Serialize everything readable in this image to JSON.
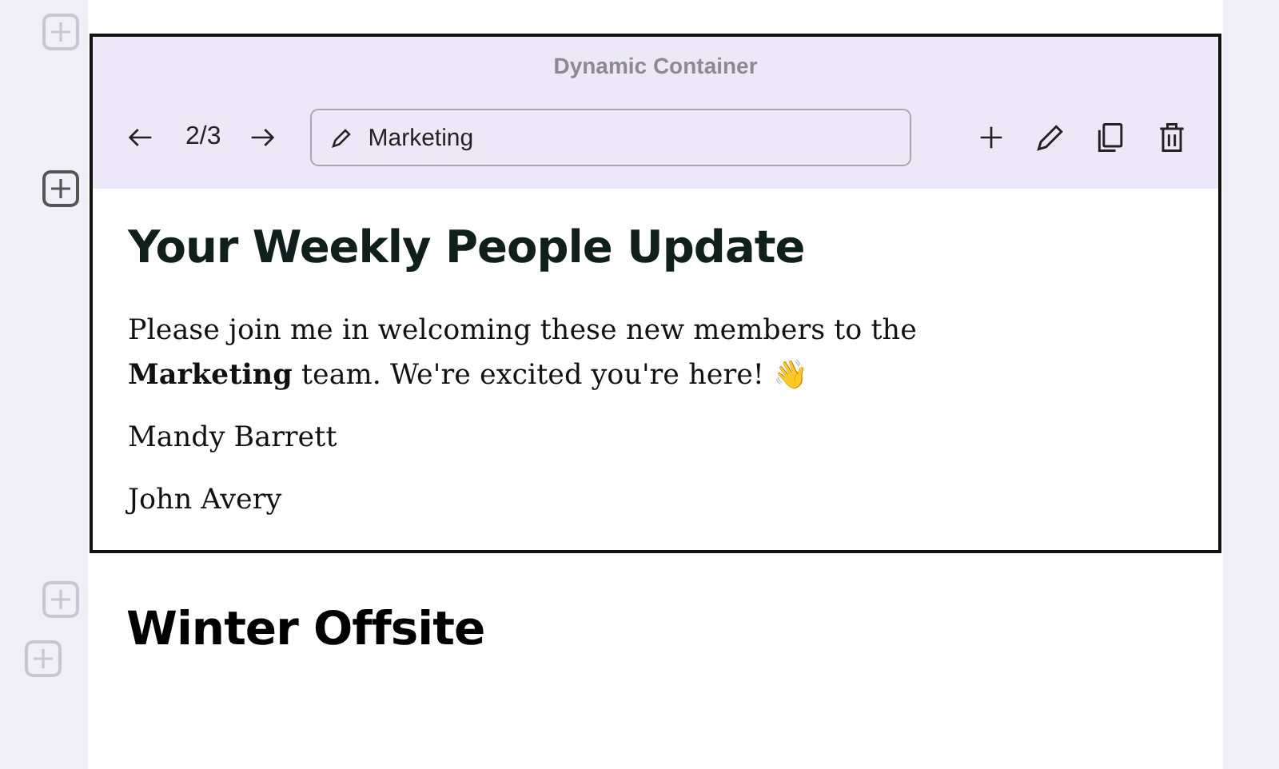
{
  "gutter_buttons": [
    {
      "highlighted": false
    },
    {
      "highlighted": true
    },
    {
      "highlighted": false
    },
    {
      "highlighted": false
    }
  ],
  "container": {
    "title": "Dynamic Container",
    "pager": {
      "current": "2/3"
    },
    "name_field": {
      "value": "Marketing"
    }
  },
  "content": {
    "heading": "Your Weekly People Update",
    "paragraphs": [
      "Please join me in welcoming these new members to the **Marketing** team. We're excited you're here! 👋",
      "Mandy Barrett",
      "John Avery"
    ]
  },
  "next_heading": "Winter Offsite"
}
